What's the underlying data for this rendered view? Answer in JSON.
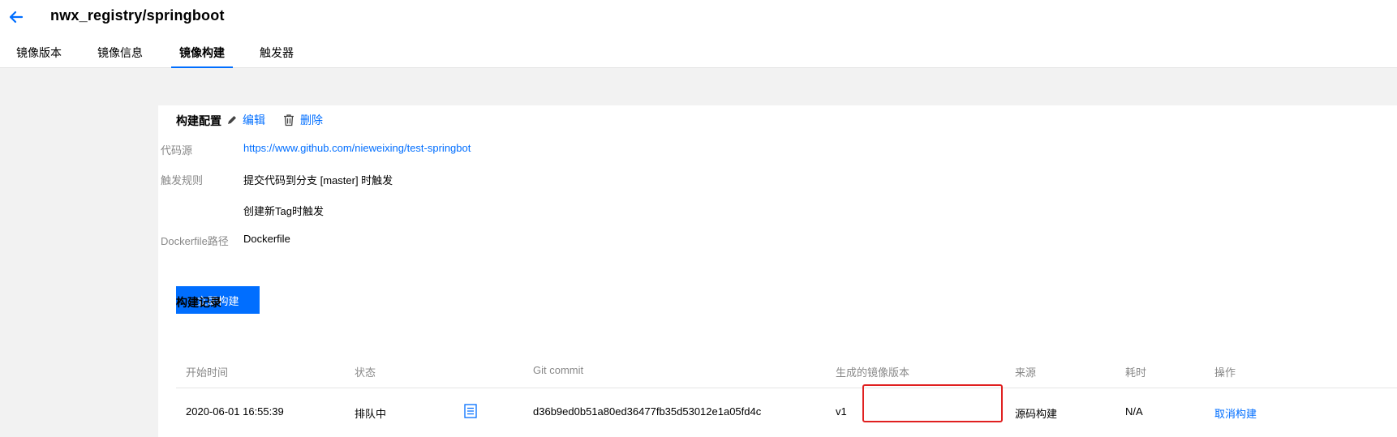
{
  "header": {
    "repo": "nwx_registry/springboot",
    "tabs": [
      {
        "label": "镜像版本"
      },
      {
        "label": "镜像信息"
      },
      {
        "label": "镜像构建"
      },
      {
        "label": "触发器"
      }
    ],
    "active_tab": 2
  },
  "config": {
    "title": "构建配置",
    "edit_label": "编辑",
    "delete_label": "删除",
    "source_label": "代码源",
    "source_value": "https://www.github.com/nieweixing/test-springbot",
    "trigger_label": "触发规则",
    "trigger_rules": [
      "提交代码到分支 [master] 时触发",
      "创建新Tag时触发"
    ],
    "dockerfile_label": "Dockerfile路径",
    "dockerfile_value": "Dockerfile",
    "build_now_label": "立即构建"
  },
  "records": {
    "title": "构建记录",
    "columns": [
      "开始时间",
      "状态",
      "Git commit",
      "生成的镜像版本",
      "来源",
      "耗时",
      "操作"
    ],
    "rows": [
      {
        "start_time": "2020-06-01 16:55:39",
        "status": "排队中",
        "commit": "d36b9ed0b51a80ed36477fb35d53012e1a05fd4c",
        "image_version": "v1",
        "source": "源码构建",
        "duration": "N/A",
        "action": "取消构建"
      }
    ]
  },
  "colors": {
    "accent": "#006eff",
    "highlight": "#e02020"
  }
}
